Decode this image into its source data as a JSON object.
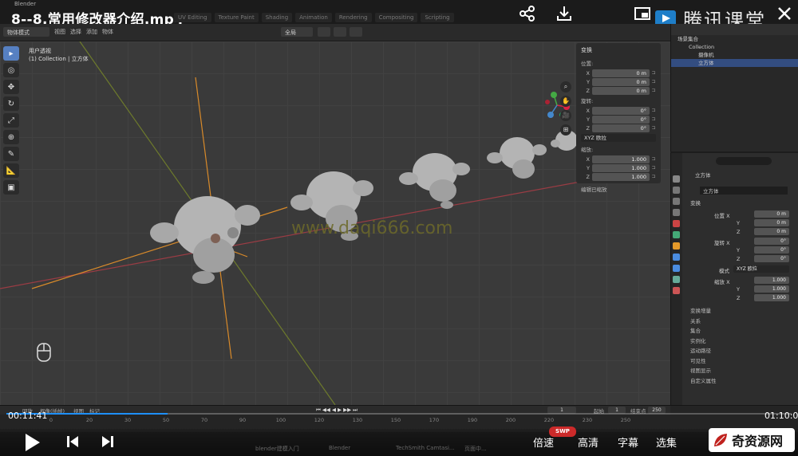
{
  "window_title": "Blender",
  "video_title": "8--8.常用修改器介绍.mp4",
  "brand_text": "腾讯课堂",
  "blender_tabs": [
    "UV Editing",
    "Texture Paint",
    "Shading",
    "Animation",
    "Rendering",
    "Compositing",
    "Scripting"
  ],
  "header": {
    "mode": "物体模式",
    "menus": [
      "视图",
      "选择",
      "添加",
      "物体"
    ],
    "transform_orientation": "全局"
  },
  "viewport": {
    "view_name": "用户透视",
    "collection_label": "(1) Collection | 立方体",
    "watermark": "www.daqi666.com"
  },
  "npanel": {
    "section_title": "变换",
    "location_label": "位置:",
    "location": [
      {
        "axis": "X",
        "value": "0 m"
      },
      {
        "axis": "Y",
        "value": "0 m"
      },
      {
        "axis": "Z",
        "value": "0 m"
      }
    ],
    "rotation_label": "旋转:",
    "rotation": [
      {
        "axis": "X",
        "value": "0°"
      },
      {
        "axis": "Y",
        "value": "0°"
      },
      {
        "axis": "Z",
        "value": "0°"
      }
    ],
    "rotation_mode": "XYZ 欧拉",
    "scale_label": "缩放:",
    "scale": [
      {
        "axis": "X",
        "value": "1.000"
      },
      {
        "axis": "Y",
        "value": "1.000"
      },
      {
        "axis": "Z",
        "value": "1.000"
      }
    ],
    "delta_label": "编辑已缩放"
  },
  "outliner": {
    "rows": [
      "场景集合",
      "Collection",
      "摄像机",
      "立方体"
    ]
  },
  "properties": {
    "object_name": "立方体",
    "object_name2": "立方体",
    "transform_title": "变换",
    "location_label": "位置 X",
    "location": [
      "0 m",
      "0 m",
      "0 m"
    ],
    "rotation_label": "旋转 X",
    "rotation": [
      "0°",
      "0°",
      "0°"
    ],
    "mode_label": "模式",
    "mode_value": "XYZ 欧拉",
    "scale_label": "缩放 X",
    "scale": [
      "1.000",
      "1.000",
      "1.000"
    ],
    "axis_y": "Y",
    "axis_z": "Z",
    "sub_sections": [
      "变换增量",
      "关系",
      "集合",
      "实例化",
      "运动路径",
      "可见性",
      "视图显示",
      "自定义属性"
    ]
  },
  "timeline": {
    "menus": [
      "回放",
      "抠像(插帧)",
      "视图",
      "标记"
    ],
    "current_frame": "1",
    "start_label": "起始",
    "start": "1",
    "end_label": "结束点",
    "end": "250",
    "ruler": [
      "0",
      "20",
      "30",
      "50",
      "70",
      "90",
      "100",
      "120",
      "130",
      "150",
      "170",
      "190",
      "200",
      "220",
      "230",
      "250"
    ]
  },
  "player": {
    "current_time": "00:11:41",
    "total_time": "01:10:0",
    "progress_pct": 20.5,
    "speed_label": "倍速",
    "quality_label": "高清",
    "subtitle_label": "字幕",
    "episodes_label": "选集",
    "swp_badge": "SWP",
    "site_logo_text": "奇资源网"
  },
  "taskbar": [
    "blender建模入门",
    "Blender",
    "TechSmith Camtasi...",
    "页面中..."
  ]
}
